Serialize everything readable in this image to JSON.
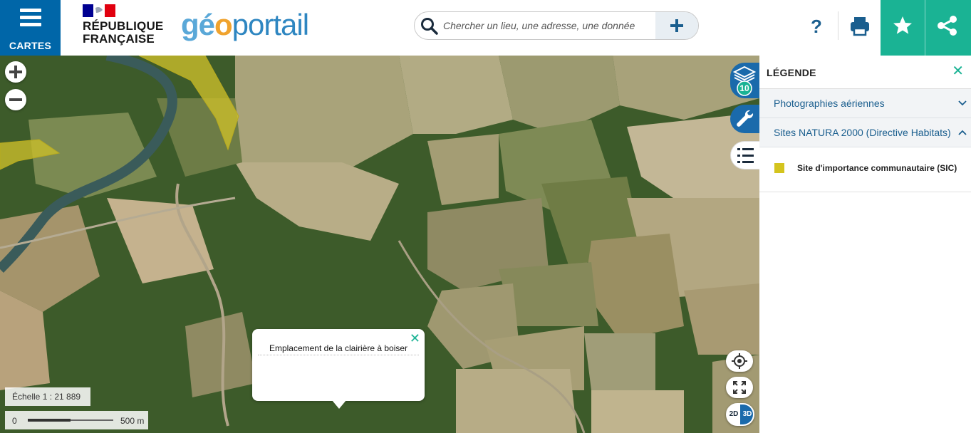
{
  "header": {
    "menu_label": "CARTES",
    "republic_line1": "RÉPUBLIQUE",
    "republic_line2": "FRANÇAISE",
    "brand_geo_a": "gé",
    "brand_geo_b": "o",
    "brand_portail": "portail",
    "search_placeholder": "Chercher un lieu, une adresse, une donnée",
    "help_label": "?"
  },
  "map": {
    "popup_title": "Emplacement de la clairière à boiser",
    "scale_label": "Échelle 1 : 21 889",
    "scale_start": "0",
    "scale_end": "500 m",
    "layers_count": "10",
    "view_2d": "2D",
    "view_3d": "3D"
  },
  "legend": {
    "title": "LÉGENDE",
    "sections": [
      {
        "label": "Photographies aériennes",
        "expanded": false
      },
      {
        "label": "Sites NATURA 2000 (Directive Habitats)",
        "expanded": true
      }
    ],
    "items": [
      {
        "label": "Site d'importance communautaire (SIC)",
        "color": "#d4c41e"
      }
    ]
  },
  "colors": {
    "primary_blue": "#0066a8",
    "accent_green": "#1ab394",
    "natura_yellow": "#d4c41e"
  }
}
